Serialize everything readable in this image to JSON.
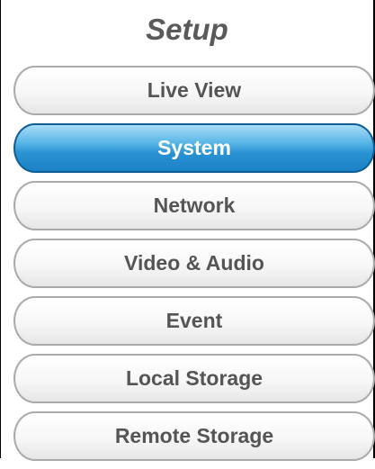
{
  "title": "Setup",
  "menu": {
    "items": [
      {
        "label": "Live View",
        "active": false
      },
      {
        "label": "System",
        "active": true
      },
      {
        "label": "Network",
        "active": false
      },
      {
        "label": "Video & Audio",
        "active": false
      },
      {
        "label": "Event",
        "active": false
      },
      {
        "label": "Local Storage",
        "active": false
      },
      {
        "label": "Remote Storage",
        "active": false
      }
    ]
  },
  "colors": {
    "active_accent": "#2a93d3",
    "title_text": "#5a5a5a",
    "button_text": "#555555"
  }
}
